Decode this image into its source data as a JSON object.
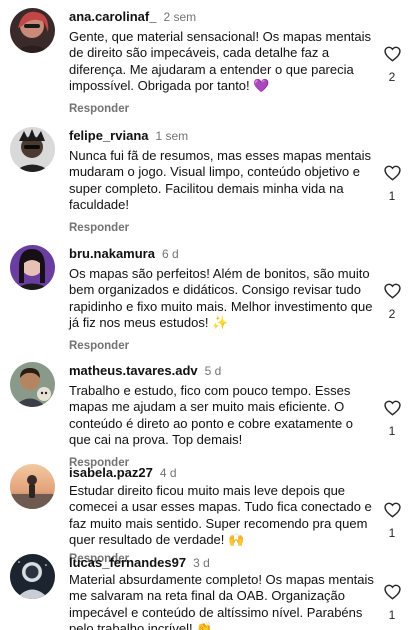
{
  "reply_label": "Responder",
  "comments": [
    {
      "user": "ana.carolinaf_",
      "time": "2 sem",
      "text": "Gente,  que material sensacional! Os mapas mentais de direito são impecáveis, cada detalhe faz a diferença. Me ajudaram a entender o que parecia impossível. Obrigada por tanto! 💜",
      "likes": "2"
    },
    {
      "user": "felipe_rviana",
      "time": "1 sem",
      "text": "Nunca fui fã de resumos, mas esses mapas mentais mudaram o jogo. Visual limpo, conteúdo objetivo e super completo. Facilitou demais minha vida na faculdade!",
      "likes": "1"
    },
    {
      "user": "bru.nakamura",
      "time": "6 d",
      "text": "Os mapas são perfeitos! Além de bonitos, são muito bem organizados e didáticos. Consigo revisar tudo rapidinho e fixo muito mais. Melhor investimento que já fiz nos meus estudos! ✨",
      "likes": "2"
    },
    {
      "user": "matheus.tavares.adv",
      "time": "5 d",
      "text": "Trabalho e estudo, fico com pouco tempo. Esses mapas me ajudam a ser muito mais eficiente. O conteúdo é direto ao ponto e cobre exatamente o que cai na prova. Top demais!",
      "likes": "1"
    },
    {
      "user": "isabela.paz27",
      "time": "4 d",
      "text": "Estudar direito ficou muito mais leve depois que comecei a usar esses mapas. Tudo fica conectado e faz muito mais sentido. Super recomendo pra quem quer resultado de verdade! 🙌",
      "likes": "1"
    },
    {
      "user": "lucas_fernandes97",
      "time": "3 d",
      "text": "Material absurdamente completo! Os mapas mentais me salvaram na reta final da OAB. Organização impecável e conteúdo de altíssimo nível. Parabéns pelo trabalho incrível! 👏",
      "likes": "1"
    }
  ]
}
